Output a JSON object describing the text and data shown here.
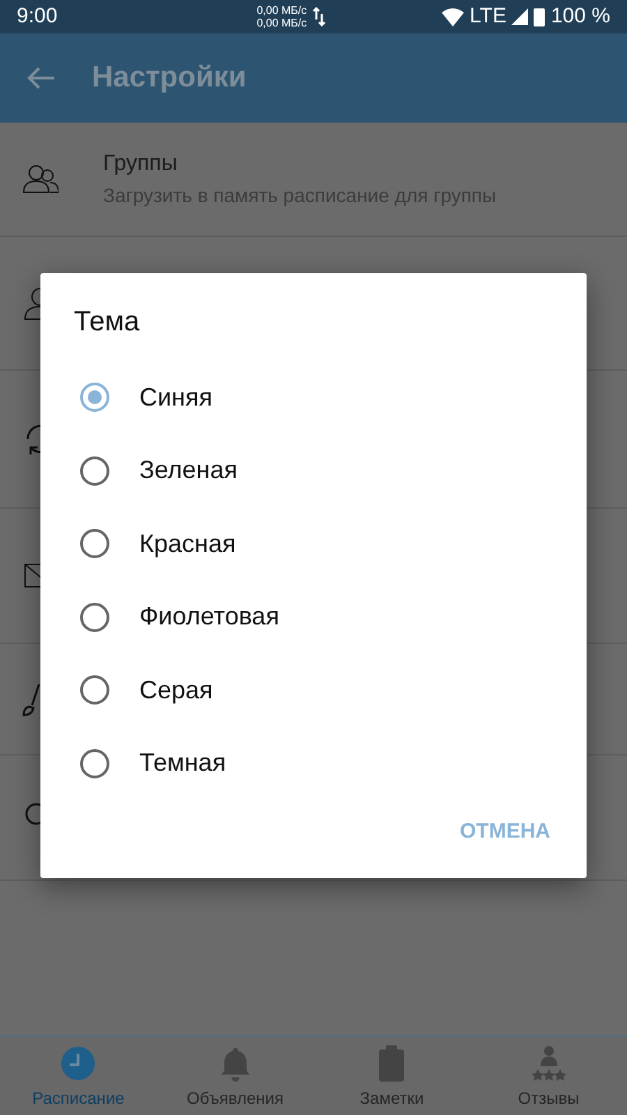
{
  "status_bar": {
    "time": "9:00",
    "upload_speed": "0,00 МБ/с",
    "download_speed": "0,00 МБ/с",
    "network": "LTE",
    "battery": "100 %"
  },
  "app_bar": {
    "title": "Настройки"
  },
  "settings": [
    {
      "kind": "groups",
      "title": "Группы",
      "subtitle": "Загрузить в память расписание для группы"
    },
    {
      "kind": "person"
    },
    {
      "kind": "sync"
    },
    {
      "kind": "mail"
    },
    {
      "kind": "brush"
    },
    {
      "kind": "search"
    }
  ],
  "dialog": {
    "title": "Тема",
    "options": [
      {
        "label": "Синяя",
        "selected": true
      },
      {
        "label": "Зеленая",
        "selected": false
      },
      {
        "label": "Красная",
        "selected": false
      },
      {
        "label": "Фиолетовая",
        "selected": false
      },
      {
        "label": "Серая",
        "selected": false
      },
      {
        "label": "Темная",
        "selected": false
      }
    ],
    "cancel": "ОТМЕНА"
  },
  "bottom_nav": [
    {
      "kind": "clock",
      "label": "Расписание",
      "selected": true
    },
    {
      "kind": "bell",
      "label": "Объявления",
      "selected": false
    },
    {
      "kind": "clipboard",
      "label": "Заметки",
      "selected": false
    },
    {
      "kind": "reviews",
      "label": "Отзывы",
      "selected": false
    }
  ]
}
